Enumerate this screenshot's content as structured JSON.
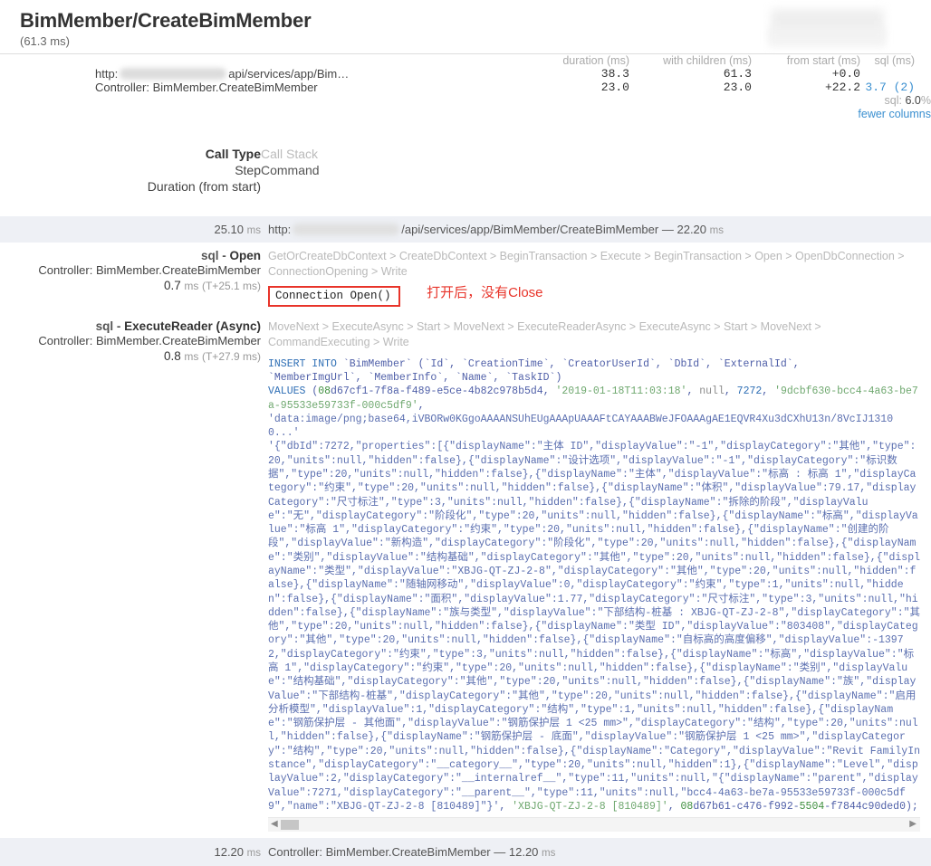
{
  "header": {
    "title": "BimMember/CreateBimMember",
    "subtitle": "(61.3 ms)"
  },
  "columns": {
    "duration": "duration (ms)",
    "with_children": "with children (ms)",
    "from_start": "from start (ms)",
    "sql": "sql (ms)"
  },
  "summary_rows": [
    {
      "name": "http:",
      "name_suffix": "api/services/app/Bim…",
      "duration": "38.3",
      "with_children": "61.3",
      "from_start": "+0.0",
      "sql": ""
    },
    {
      "name": "Controller: BimMember.CreateBimMember",
      "name_suffix": "",
      "duration": "23.0",
      "with_children": "23.0",
      "from_start": "+22.2",
      "sql": "3.7  (2)"
    }
  ],
  "sql_percent_label": "sql:",
  "sql_percent_value": "6.0",
  "sql_percent_unit": "%",
  "fewer_columns_link": "fewer columns",
  "legend": [
    {
      "left": "Call Type",
      "right": "Call Stack"
    },
    {
      "left": "Step",
      "right": "Command"
    },
    {
      "left": "Duration (from start)",
      "right": ""
    }
  ],
  "timeline": {
    "url_row": {
      "duration": "25.10",
      "unit": "ms",
      "scheme": "http:",
      "path": "/api/services/app/BimMember/CreateBimMember",
      "dash": "—",
      "elapsed": "22.20",
      "elapsed_unit": "ms"
    },
    "open_row": {
      "type_prefix": "sql",
      "type_sep": " - ",
      "type_op": "Open",
      "controller": "Controller: BimMember.CreateBimMember",
      "time_value": "0.7",
      "time_unit": "ms",
      "time_offset": "(T+25.1 ms)",
      "stack": "GetOrCreateDbContext > CreateDbContext > BeginTransaction > Execute > BeginTransaction > Open > OpenDbConnection > ConnectionOpening > Write",
      "command": "Connection Open()",
      "annotation": "打开后，没有Close",
      "annotation_color": "#e8342a"
    },
    "reader_row": {
      "type_prefix": "sql",
      "type_sep": " - ",
      "type_op": "ExecuteReader (Async)",
      "controller": "Controller: BimMember.CreateBimMember",
      "time_value": "0.8",
      "time_unit": "ms",
      "time_offset": "(T+27.9 ms)",
      "stack": "MoveNext > ExecuteAsync > Start > MoveNext > ExecuteReaderAsync > ExecuteAsync > Start > MoveNext > CommandExecuting > Write",
      "sql_line1_kw": "INSERT INTO",
      "sql_line1_rest": " `BimMember` (`Id`, `CreationTime`, `CreatorUserId`, `DbId`, `ExternalId`,\n`MemberImgUrl`, `MemberInfo`, `Name`, `TaskID`)",
      "sql_values_kw": "VALUES",
      "sql_guid1_hi": "08",
      "sql_guid1_rest": "d67cf1-7f8a-f489-e5ce-4b82c978b5d4",
      "sql_date": "'2019-01-18T11:03:18'",
      "sql_null": "null",
      "sql_dbid": "7272",
      "sql_extid": "'9dcbf630-bcc4-4a63-be7a-95533e59733f-000c5df9'",
      "sql_blob": "'data:image/png;base64,iVBORw0KGgoAAAANSUhEUgAAApUAAAFtCAYAAABWeJFOAAAgAE1EQVR4Xu3dCXhU13n/8VcIJ13100...'",
      "sql_body": "'{\"dbId\":7272,\"properties\":[{\"displayName\":\"主体 ID\",\"displayValue\":\"-1\",\"displayCategory\":\"其他\",\"type\":20,\"units\":null,\"hidden\":false},{\"displayName\":\"设计选项\",\"displayValue\":\"-1\",\"displayCategory\":\"标识数据\",\"type\":20,\"units\":null,\"hidden\":false},{\"displayName\":\"主体\",\"displayValue\":\"标高 : 标高 1\",\"displayCategory\":\"约束\",\"type\":20,\"units\":null,\"hidden\":false},{\"displayName\":\"体积\",\"displayValue\":79.17,\"displayCategory\":\"尺寸标注\",\"type\":3,\"units\":null,\"hidden\":false},{\"displayName\":\"拆除的阶段\",\"displayValue\":\"无\",\"displayCategory\":\"阶段化\",\"type\":20,\"units\":null,\"hidden\":false},{\"displayName\":\"标高\",\"displayValue\":\"标高 1\",\"displayCategory\":\"约束\",\"type\":20,\"units\":null,\"hidden\":false},{\"displayName\":\"创建的阶段\",\"displayValue\":\"新构造\",\"displayCategory\":\"阶段化\",\"type\":20,\"units\":null,\"hidden\":false},{\"displayName\":\"类别\",\"displayValue\":\"结构基础\",\"displayCategory\":\"其他\",\"type\":20,\"units\":null,\"hidden\":false},{\"displayName\":\"类型\",\"displayValue\":\"XBJG-QT-ZJ-2-8\",\"displayCategory\":\"其他\",\"type\":20,\"units\":null,\"hidden\":false},{\"displayName\":\"随轴网移动\",\"displayValue\":0,\"displayCategory\":\"约束\",\"type\":1,\"units\":null,\"hidden\":false},{\"displayName\":\"面积\",\"displayValue\":1.77,\"displayCategory\":\"尺寸标注\",\"type\":3,\"units\":null,\"hidden\":false},{\"displayName\":\"族与类型\",\"displayValue\":\"下部结构-桩基 : XBJG-QT-ZJ-2-8\",\"displayCategory\":\"其他\",\"type\":20,\"units\":null,\"hidden\":false},{\"displayName\":\"类型 ID\",\"displayValue\":\"803408\",\"displayCategory\":\"其他\",\"type\":20,\"units\":null,\"hidden\":false},{\"displayName\":\"自标高的高度偏移\",\"displayValue\":-13972,\"displayCategory\":\"约束\",\"type\":3,\"units\":null,\"hidden\":false},{\"displayName\":\"标高\",\"displayValue\":\"标高 1\",\"displayCategory\":\"约束\",\"type\":20,\"units\":null,\"hidden\":false},{\"displayName\":\"类别\",\"displayValue\":\"结构基础\",\"displayCategory\":\"其他\",\"type\":20,\"units\":null,\"hidden\":false},{\"displayName\":\"族\",\"displayValue\":\"下部结构-桩基\",\"displayCategory\":\"其他\",\"type\":20,\"units\":null,\"hidden\":false},{\"displayName\":\"启用分析模型\",\"displayValue\":1,\"displayCategory\":\"结构\",\"type\":1,\"units\":null,\"hidden\":false},{\"displayName\":\"钢筋保护层 - 其他面\",\"displayValue\":\"钢筋保护层 1 <25 mm>\",\"displayCategory\":\"结构\",\"type\":20,\"units\":null,\"hidden\":false},{\"displayName\":\"钢筋保护层 - 底面\",\"displayValue\":\"钢筋保护层 1 <25 mm>\",\"displayCategory\":\"结构\",\"type\":20,\"units\":null,\"hidden\":false},{\"displayName\":\"Category\",\"displayValue\":\"Revit FamilyInstance\",\"displayCategory\":\"__category__\",\"type\":20,\"units\":null,\"hidden\":1},{\"displayName\":\"Level\",\"displayValue\":2,\"displayCategory\":\"__internalref__\",\"type\":11,\"units\":null,\"{\"displayName\":\"parent\",\"displayValue\":7271,\"displayCategory\":\"__parent__\",\"type\":11,\"units\":null,\"bcc4-4a63-be7a-95533e59733f-000c5df9\",\"name\":\"XBJG-QT-ZJ-2-8 [810489]\"}'",
      "sql_name_literal": "'XBJG-QT-ZJ-2-8 [810489]'",
      "sql_guid2_hi": "08",
      "sql_guid2_mid": "d67b61-c476-f992-",
      "sql_guid2_acc": "5504",
      "sql_guid2_rest": "-f7844c90ded0);"
    },
    "footer_row": {
      "duration": "12.20",
      "unit": "ms",
      "text": "Controller: BimMember.CreateBimMember",
      "dash": "—",
      "elapsed": "12.20",
      "elapsed_unit": "ms"
    }
  },
  "scrollbar": {
    "left_arrow": "◀",
    "right_arrow": "▶"
  }
}
